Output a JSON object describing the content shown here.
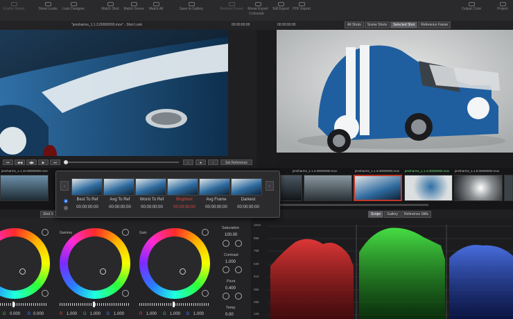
{
  "toolbar": {
    "items": [
      "Enable Import",
      "Show Looks",
      "Look Designer",
      "Match Shot",
      "Match Scene",
      "Match All",
      "Save to Gallery",
      "Restore Preset",
      "Movie Export",
      "Still Export",
      "PDF Export",
      "Output Color",
      "Project"
    ],
    "section": "Colourlab"
  },
  "viewer": {
    "left_title": "\"jensharms_1.1.3.00000000.mov\" - Shot Look",
    "left_timecode": "00:00:00:00",
    "right_timecode": "00:00:00:00",
    "modes": [
      "All Shots",
      "Scene Shots",
      "Selected Shot",
      "Reference Frame"
    ]
  },
  "transport": {
    "set_reference": "Set Reference"
  },
  "filmstrip": {
    "clips": [
      {
        "label": "jensharms_1.1.10.00000000.mov"
      },
      {
        "label": "jensharms_1.1.2.00000000.mov"
      },
      {
        "label": "jensharms_1.1.3.00000000.mov"
      },
      {
        "label": "jensharms_1.1.4.00000000.mov"
      },
      {
        "label": "jensharms_1.1.5.00000000.mov"
      }
    ]
  },
  "popup": {
    "options": [
      {
        "label": "Best To Ref",
        "time": "00:00:00:00",
        "selected": true
      },
      {
        "label": "Avg To Ref",
        "time": "00:00:00:00",
        "selected": false
      },
      {
        "label": "Worst To Ref",
        "time": "00:00:00:00",
        "selected": false
      },
      {
        "label": "Brightest",
        "time": "00:00:00:00",
        "selected": false,
        "highlight": "#e0443b"
      },
      {
        "label": "Avg Frame",
        "time": "00:00:00:00",
        "selected": false
      },
      {
        "label": "Darkest",
        "time": "00:00:00:00",
        "selected": false
      }
    ]
  },
  "panel_tabs": {
    "left": "Shot S",
    "right": [
      "Scope",
      "Gallery",
      "Reference Stills"
    ]
  },
  "wheels": [
    {
      "label": "",
      "g": "0.000",
      "b": "0.000"
    },
    {
      "label": "Gamma",
      "r": "1.000",
      "g": "1.000",
      "b": "1.000"
    },
    {
      "label": "Gain",
      "r": "1.000",
      "g": "1.000",
      "b": "1.000"
    }
  ],
  "params": {
    "saturation_label": "Saturation",
    "saturation": "100.00",
    "contrast_label": "Contrast",
    "contrast": "1.000",
    "pivot_label": "Pivot",
    "pivot": "0.400",
    "temp_label": "Temp",
    "temp": "0.00"
  },
  "scope": {
    "ticks": [
      "1023",
      "896",
      "768",
      "640",
      "512",
      "384",
      "256",
      "128"
    ]
  },
  "colors": {
    "red": "#e0443b",
    "green": "#3ec54a",
    "blue": "#3a7bff",
    "selected_clip_border": "#c0392b"
  }
}
